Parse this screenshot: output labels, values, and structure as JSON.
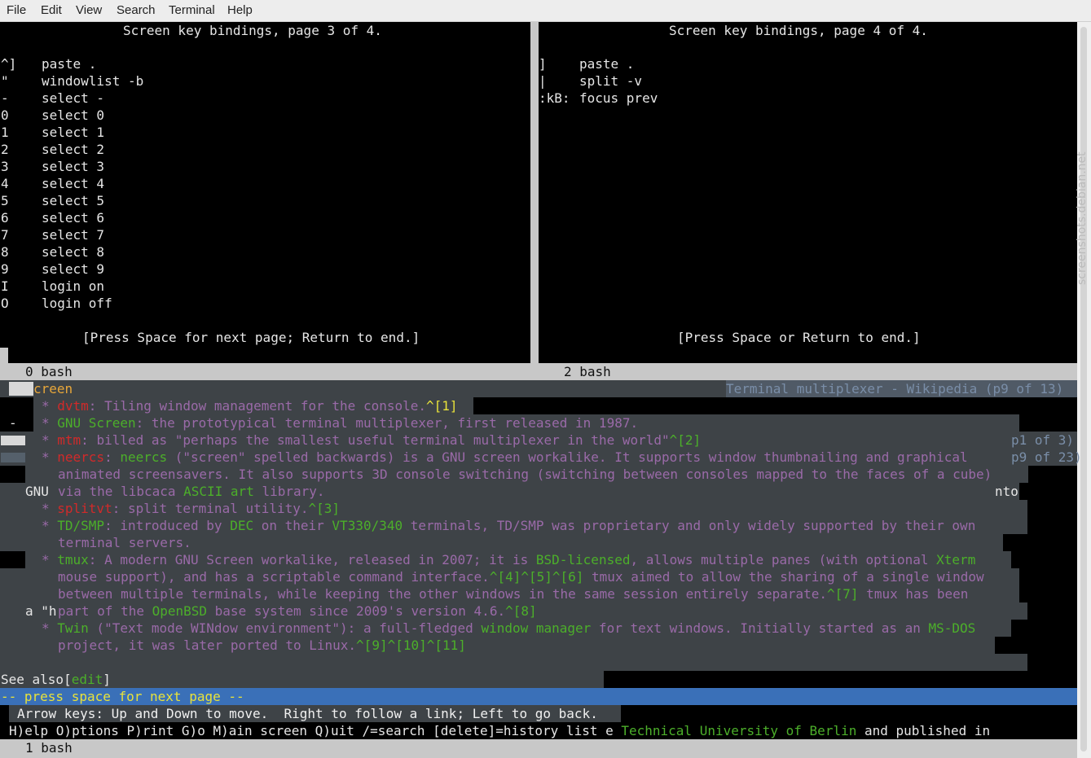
{
  "menu": {
    "file": "File",
    "edit": "Edit",
    "view": "View",
    "search": "Search",
    "terminal": "Terminal",
    "help": "Help"
  },
  "left": {
    "title": "Screen key bindings, page 3 of 4.",
    "rows": [
      {
        "k": "^]",
        "v": "paste ."
      },
      {
        "k": "\"",
        "v": "windowlist -b"
      },
      {
        "k": "-",
        "v": "select -"
      },
      {
        "k": "0",
        "v": "select 0"
      },
      {
        "k": "1",
        "v": "select 1"
      },
      {
        "k": "2",
        "v": "select 2"
      },
      {
        "k": "3",
        "v": "select 3"
      },
      {
        "k": "4",
        "v": "select 4"
      },
      {
        "k": "5",
        "v": "select 5"
      },
      {
        "k": "6",
        "v": "select 6"
      },
      {
        "k": "7",
        "v": "select 7"
      },
      {
        "k": "8",
        "v": "select 8"
      },
      {
        "k": "9",
        "v": "select 9"
      },
      {
        "k": "I",
        "v": "login on"
      },
      {
        "k": "O",
        "v": "login off"
      }
    ],
    "footer": "[Press Space for next page; Return to end.]",
    "status": "0 bash"
  },
  "right": {
    "title": "Screen key bindings, page 4 of 4.",
    "rows": [
      {
        "k": "]",
        "v": "paste ."
      },
      {
        "k": "|",
        "v": "split -v"
      },
      {
        "k": ":kB:",
        "v": "focus prev"
      }
    ],
    "footer": "[Press Space or Return to end.]",
    "status": "2 bash"
  },
  "lynx": {
    "top_left": "creen",
    "top_right": "Terminal multiplexer - Wikipedia (p9 of 13)",
    "p_right1": "p1 of 3)",
    "p_right2": "p9 of 23)",
    "gnu": "GNU",
    "nto": "nto",
    "ah": "a \"h",
    "dash": "-",
    "l1_bullet": "* ",
    "l1_link": "dvtm",
    "l1_text": ": Tiling window management for the console.",
    "l1_ref": "^[1]",
    "l2_bullet": "* ",
    "l2_link": "GNU Screen",
    "l2_text": ": the prototypical terminal multiplexer, first released in 1987.",
    "l3_bullet": "* ",
    "l3_link": "mtm",
    "l3_text": ": billed as \"perhaps the smallest useful terminal multiplexer in the world\"",
    "l3_ref": "^[2]",
    "l4_bullet": "* ",
    "l4_link": "neercs",
    "l4_text1": ": ",
    "l4_link2": "neercs",
    "l4_text2": " (\"screen\" spelled backwards) is a GNU screen workalike. It supports window thumbnailing and graphical",
    "l5_text": "animated screensavers. It also supports 3D console switching (switching between consoles mapped to the faces of a cube)",
    "l6_text1": "via the libcaca ",
    "l6_link": "ASCII art",
    "l6_text2": " library.",
    "l7_bullet": "* ",
    "l7_link": "splitvt",
    "l7_text": ": split terminal utility.",
    "l7_ref": "^[3]",
    "l8_bullet": "* ",
    "l8_link": "TD/SMP",
    "l8_text1": ": introduced by ",
    "l8_link2": "DEC",
    "l8_text2": " on their ",
    "l8_link3": "VT330/340",
    "l8_text3": " terminals, TD/SMP was proprietary and only widely supported by their own",
    "l9_text": "terminal servers.",
    "l10_bullet": "* ",
    "l10_link": "tmux",
    "l10_text1": ": A modern GNU Screen workalike, released in 2007; it is ",
    "l10_link2": "BSD-licensed",
    "l10_text2": ", allows multiple panes (with optional ",
    "l10_link3": "Xterm",
    "l11_text1": "mouse support), and has a scriptable command interface.",
    "l11_ref": "^[4]^[5]^[6]",
    "l11_text2": " tmux aimed to allow the sharing of a single window",
    "l12_text1": "between multiple terminals, while keeping the other windows in the same session entirely separate.",
    "l12_ref": "^[7]",
    "l12_text2": " tmux has been",
    "l13_text1": "part of the ",
    "l13_link": "OpenBSD",
    "l13_text2": " base system since 2009's version 4.6.",
    "l13_ref": "^[8]",
    "l14_bullet": "* ",
    "l14_link": "Twin",
    "l14_text1": " (\"Text mode WINdow environment\"): a full-fledged ",
    "l14_link2": "window manager",
    "l14_text2": " for text windows. Initially started as an ",
    "l14_link3": "MS-DOS",
    "l15_text": "project, it was later ported to Linux.",
    "l15_ref": "^[9]^[10]^[11]",
    "see_also": "See also[",
    "see_edit": "edit",
    "see_close": "]",
    "prompt": "-- press space for next page --",
    "help1": "Arrow keys: Up and Down to move.  Right to follow a link; Left to go back.",
    "help2a": "H)elp O)ptions P)rint G)o M)ain screen Q)uit /=search [delete]=history list e ",
    "help2_link": "Technical University of Berlin",
    "help2b": " and published in",
    "status": "1 bash"
  },
  "watermark": "screenshots.debian.net"
}
